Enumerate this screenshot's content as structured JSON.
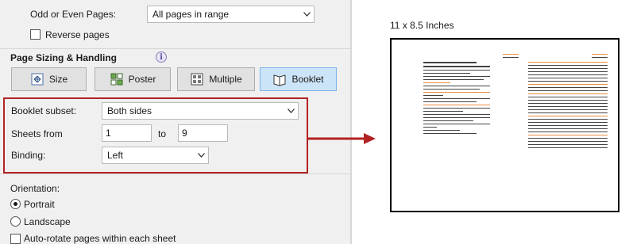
{
  "pages": {
    "label": "Odd or Even Pages:",
    "value": "All pages in range"
  },
  "reverse_pages": {
    "label": "Reverse pages",
    "checked": false
  },
  "page_sizing": {
    "title": "Page Sizing & Handling",
    "info_icon": "info-icon",
    "buttons": [
      {
        "label": "Size",
        "icon": "size-icon",
        "active": false
      },
      {
        "label": "Poster",
        "icon": "poster-icon",
        "active": false
      },
      {
        "label": "Multiple",
        "icon": "multiple-icon",
        "active": false
      },
      {
        "label": "Booklet",
        "icon": "booklet-icon",
        "active": true
      }
    ]
  },
  "booklet": {
    "subset_label": "Booklet subset:",
    "subset_value": "Both sides",
    "sheets_label": "Sheets from",
    "sheets_from": "1",
    "to_label": "to",
    "sheets_to": "9",
    "binding_label": "Binding:",
    "binding_value": "Left"
  },
  "orientation": {
    "label": "Orientation:",
    "options": [
      {
        "label": "Portrait",
        "selected": true
      },
      {
        "label": "Landscape",
        "selected": false
      }
    ],
    "auto_rotate_label": "Auto-rotate pages within each sheet",
    "auto_rotate_checked": false
  },
  "preview": {
    "size_label": "11 x 8.5 Inches"
  },
  "colors": {
    "highlight_box": "#b22222",
    "active_button": "#cce4f7",
    "accent_text": "#e07b1b"
  }
}
